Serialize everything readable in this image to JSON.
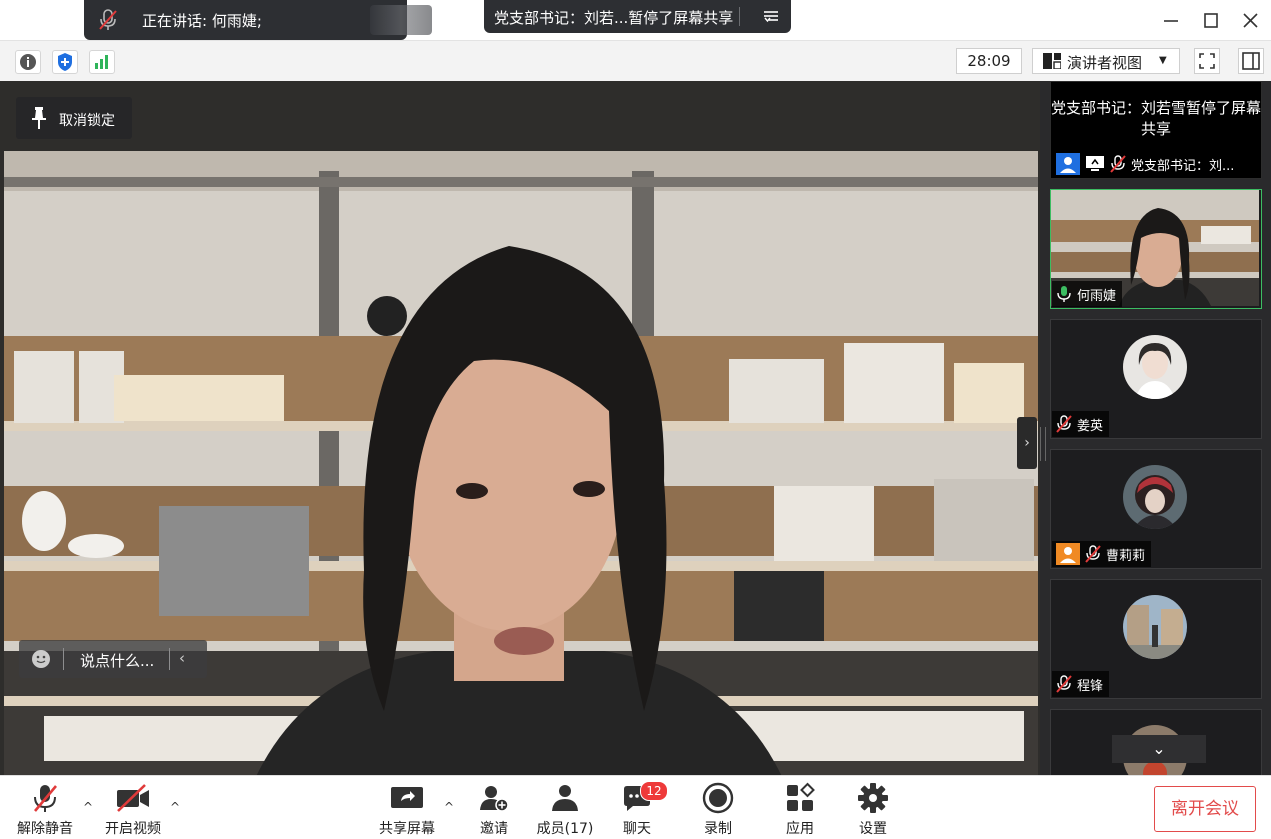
{
  "titlebar": {
    "speaking_text": "正在讲话: 何雨婕;",
    "share_text": "党支部书记：刘若...暂停了屏幕共享"
  },
  "infobar": {
    "timer": "28:09",
    "view_label": "演讲者视图"
  },
  "main": {
    "unlock_label": "取消锁定",
    "chat_placeholder": "说点什么..."
  },
  "panel": {
    "share_message": "党支部书记：刘若雪暂停了屏幕共享",
    "share_tag": "党支部书记：刘...",
    "participants": [
      {
        "name": "何雨婕",
        "mic": "on"
      },
      {
        "name": "姜英",
        "mic": "muted"
      },
      {
        "name": "曹莉莉",
        "mic": "muted"
      },
      {
        "name": "程锋",
        "mic": "muted"
      }
    ]
  },
  "toolbar": {
    "unmute_label": "解除静音",
    "video_label": "开启视频",
    "share_label": "共享屏幕",
    "invite_label": "邀请",
    "members_label": "成员(17)",
    "chat_label": "聊天",
    "chat_badge": "12",
    "record_label": "录制",
    "apps_label": "应用",
    "settings_label": "设置",
    "leave_label": "离开会议"
  },
  "colors": {
    "accent_green": "#3cbd62",
    "leave_red": "#e24b4b",
    "badge_red": "#ee3a3a",
    "mute_red": "#e03a3a",
    "shield_blue": "#1f6fe0"
  }
}
